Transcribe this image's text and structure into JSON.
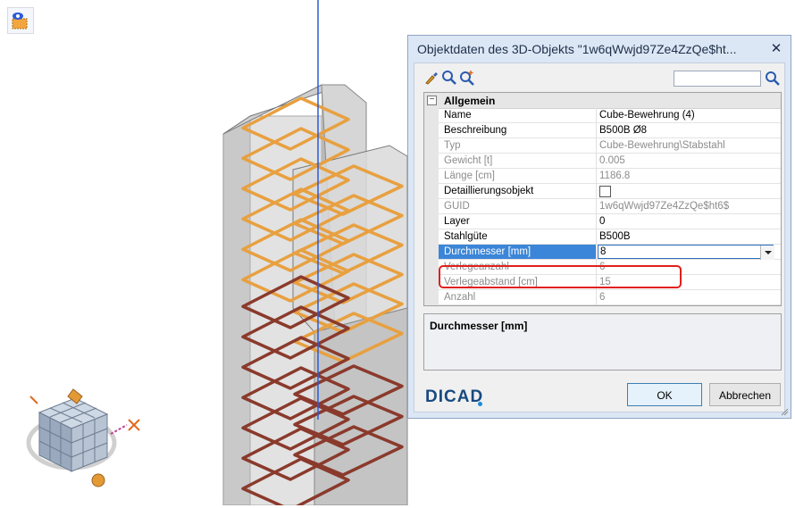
{
  "dialog": {
    "title": "Objektdaten des 3D-Objekts \"1w6qWwjd97Ze4ZzQe$ht...",
    "close_glyph": "✕",
    "toolbar": {
      "icons": [
        "brush-icon",
        "zoom-icon",
        "zoom-plus-icon"
      ],
      "search_value": "",
      "search_icon": "search-icon"
    },
    "category": {
      "label": "Allgemein",
      "toggle": "−"
    },
    "properties": [
      {
        "key": "Name",
        "value": "Cube-Bewehrung (4)",
        "readonly": false
      },
      {
        "key": "Beschreibung",
        "value": "B500B Ø8",
        "readonly": false
      },
      {
        "key": "Typ",
        "value": "Cube-Bewehrung\\Stabstahl",
        "readonly": true
      },
      {
        "key": "Gewicht [t]",
        "value": "0.005",
        "readonly": true
      },
      {
        "key": "Länge [cm]",
        "value": "1186.8",
        "readonly": true
      },
      {
        "key": "Detaillierungsobjekt",
        "value": "",
        "readonly": false,
        "checkbox": true
      },
      {
        "key": "GUID",
        "value": "1w6qWwjd97Ze4ZzQe$ht6$",
        "readonly": true
      },
      {
        "key": "Layer",
        "value": "0",
        "readonly": false
      },
      {
        "key": "Stahlgüte",
        "value": "B500B",
        "readonly": false
      },
      {
        "key": "Durchmesser [mm]",
        "value": "8",
        "readonly": false,
        "selected": true
      },
      {
        "key": "Verlegeanzahl",
        "value": "6",
        "readonly": true
      },
      {
        "key": "Verlegeabstand [cm]",
        "value": "15",
        "readonly": true
      },
      {
        "key": "Anzahl",
        "value": "6",
        "readonly": true
      }
    ],
    "description": {
      "title": "Durchmesser [mm]"
    },
    "logo": "DICAD",
    "buttons": {
      "ok": "OK",
      "cancel": "Abbrechen"
    }
  },
  "colors": {
    "accent_selection": "#3b86d8",
    "highlight_box": "#e0201c",
    "rebar_orange": "#e8a040",
    "rebar_red": "#8a3a2c",
    "axis_blue": "#2a5bd8"
  }
}
